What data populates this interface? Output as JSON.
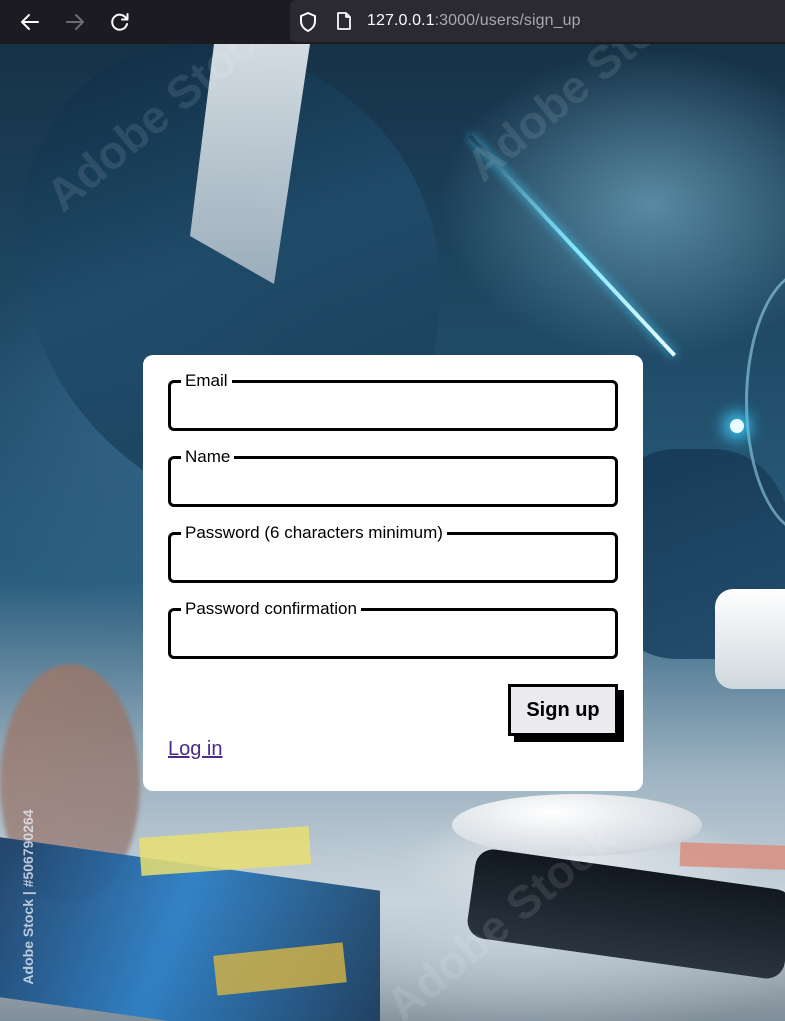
{
  "browser": {
    "url_host": "127.0.0.1",
    "url_path": ":3000/users/sign_up",
    "icons": {
      "back": "arrow-left-icon",
      "forward": "arrow-right-icon",
      "reload": "reload-icon",
      "tracking": "shield-icon",
      "page": "page-icon"
    }
  },
  "background": {
    "watermark_side": "Adobe Stock | #506790264",
    "watermark_faint": "Adobe Stock"
  },
  "form": {
    "fields": [
      {
        "label": "Email",
        "value": ""
      },
      {
        "label": "Name",
        "value": ""
      },
      {
        "label": "Password (6 characters minimum)",
        "value": ""
      },
      {
        "label": "Password confirmation",
        "value": ""
      }
    ],
    "submit_label": "Sign up",
    "login_link": "Log in"
  },
  "colors": {
    "chrome_bg": "#1c1b22",
    "urlbar_bg": "#2b2a33",
    "card_bg": "#ffffff",
    "border": "#000000",
    "button_bg": "#ebeaee",
    "link": "#4b2a8a"
  }
}
